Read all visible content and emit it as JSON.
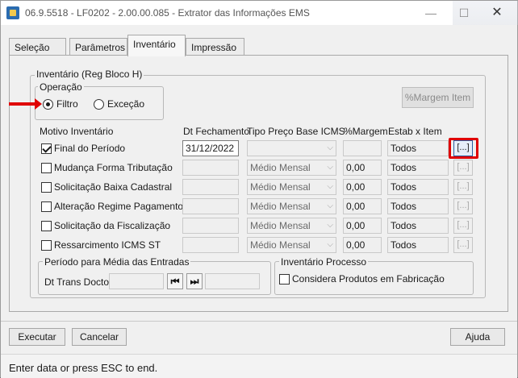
{
  "window": {
    "title": "06.9.5518 - LF0202 - 2.00.00.085 - Extrator das Informações EMS",
    "minimize_glyph": "—",
    "maximize_glyph": "☐",
    "close_glyph": "✕"
  },
  "tabs": [
    {
      "label": "Seleção",
      "active": false
    },
    {
      "label": "Parâmetros",
      "active": false
    },
    {
      "label": "Inventário",
      "active": true
    },
    {
      "label": "Impressão",
      "active": false
    }
  ],
  "inventario": {
    "group_title": "Inventário (Reg Bloco H)",
    "operacao": {
      "title": "Operação",
      "options": [
        {
          "label": "Filtro",
          "selected": true
        },
        {
          "label": "Exceção",
          "selected": false
        }
      ]
    },
    "margem_button": "%Margem Item",
    "headers": {
      "motivo": "Motivo Inventário",
      "dt_fechamento": "Dt Fechamento",
      "tipo_preco": "Tipo Preço Base ICMS",
      "margem": "%Margem",
      "estab": "Estab x Item"
    },
    "rows": [
      {
        "label": "Final do Período",
        "checked": true,
        "date": "31/12/2022",
        "tipo": "",
        "margem": "",
        "estab": "Todos",
        "dots": "[...]"
      },
      {
        "label": "Mudança Forma Tributação",
        "checked": false,
        "date": "",
        "tipo": "Médio Mensal",
        "margem": "0,00",
        "estab": "Todos",
        "dots": "[...]"
      },
      {
        "label": "Solicitação Baixa Cadastral",
        "checked": false,
        "date": "",
        "tipo": "Médio Mensal",
        "margem": "0,00",
        "estab": "Todos",
        "dots": "[...]"
      },
      {
        "label": "Alteração Regime Pagamento",
        "checked": false,
        "date": "",
        "tipo": "Médio Mensal",
        "margem": "0,00",
        "estab": "Todos",
        "dots": "[...]"
      },
      {
        "label": "Solicitação da Fiscalização",
        "checked": false,
        "date": "",
        "tipo": "Médio Mensal",
        "margem": "0,00",
        "estab": "Todos",
        "dots": "[...]"
      },
      {
        "label": "Ressarcimento ICMS ST",
        "checked": false,
        "date": "",
        "tipo": "Médio Mensal",
        "margem": "0,00",
        "estab": "Todos",
        "dots": "[...]"
      }
    ],
    "periodo": {
      "title": "Período para Média das Entradas",
      "label": "Dt Trans Docto:",
      "first_glyph": "⏮",
      "last_glyph": "⏭"
    },
    "processo": {
      "title": "Inventário Processo",
      "checkbox_label": "Considera Produtos em Fabricação",
      "checked": false
    }
  },
  "buttons": {
    "executar": "Executar",
    "cancelar": "Cancelar",
    "ajuda": "Ajuda"
  },
  "status": "Enter data or press ESC to end.",
  "colors": {
    "highlight": "#e00000",
    "accent": "#2b5d9e"
  }
}
